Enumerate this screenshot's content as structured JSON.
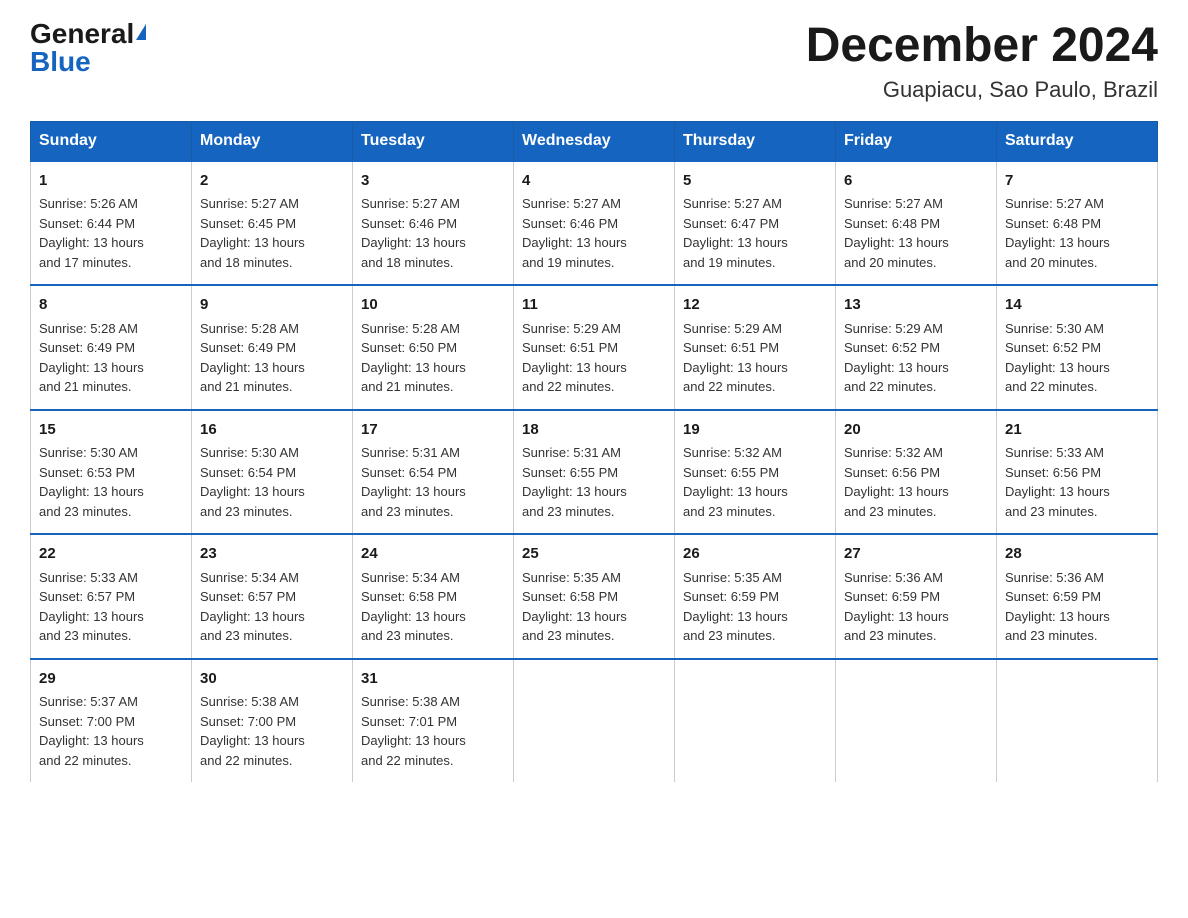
{
  "logo": {
    "general": "General",
    "blue": "Blue"
  },
  "title": "December 2024",
  "subtitle": "Guapiacu, Sao Paulo, Brazil",
  "days_of_week": [
    "Sunday",
    "Monday",
    "Tuesday",
    "Wednesday",
    "Thursday",
    "Friday",
    "Saturday"
  ],
  "weeks": [
    [
      {
        "day": "1",
        "sunrise": "5:26 AM",
        "sunset": "6:44 PM",
        "daylight": "13 hours and 17 minutes."
      },
      {
        "day": "2",
        "sunrise": "5:27 AM",
        "sunset": "6:45 PM",
        "daylight": "13 hours and 18 minutes."
      },
      {
        "day": "3",
        "sunrise": "5:27 AM",
        "sunset": "6:46 PM",
        "daylight": "13 hours and 18 minutes."
      },
      {
        "day": "4",
        "sunrise": "5:27 AM",
        "sunset": "6:46 PM",
        "daylight": "13 hours and 19 minutes."
      },
      {
        "day": "5",
        "sunrise": "5:27 AM",
        "sunset": "6:47 PM",
        "daylight": "13 hours and 19 minutes."
      },
      {
        "day": "6",
        "sunrise": "5:27 AM",
        "sunset": "6:48 PM",
        "daylight": "13 hours and 20 minutes."
      },
      {
        "day": "7",
        "sunrise": "5:27 AM",
        "sunset": "6:48 PM",
        "daylight": "13 hours and 20 minutes."
      }
    ],
    [
      {
        "day": "8",
        "sunrise": "5:28 AM",
        "sunset": "6:49 PM",
        "daylight": "13 hours and 21 minutes."
      },
      {
        "day": "9",
        "sunrise": "5:28 AM",
        "sunset": "6:49 PM",
        "daylight": "13 hours and 21 minutes."
      },
      {
        "day": "10",
        "sunrise": "5:28 AM",
        "sunset": "6:50 PM",
        "daylight": "13 hours and 21 minutes."
      },
      {
        "day": "11",
        "sunrise": "5:29 AM",
        "sunset": "6:51 PM",
        "daylight": "13 hours and 22 minutes."
      },
      {
        "day": "12",
        "sunrise": "5:29 AM",
        "sunset": "6:51 PM",
        "daylight": "13 hours and 22 minutes."
      },
      {
        "day": "13",
        "sunrise": "5:29 AM",
        "sunset": "6:52 PM",
        "daylight": "13 hours and 22 minutes."
      },
      {
        "day": "14",
        "sunrise": "5:30 AM",
        "sunset": "6:52 PM",
        "daylight": "13 hours and 22 minutes."
      }
    ],
    [
      {
        "day": "15",
        "sunrise": "5:30 AM",
        "sunset": "6:53 PM",
        "daylight": "13 hours and 23 minutes."
      },
      {
        "day": "16",
        "sunrise": "5:30 AM",
        "sunset": "6:54 PM",
        "daylight": "13 hours and 23 minutes."
      },
      {
        "day": "17",
        "sunrise": "5:31 AM",
        "sunset": "6:54 PM",
        "daylight": "13 hours and 23 minutes."
      },
      {
        "day": "18",
        "sunrise": "5:31 AM",
        "sunset": "6:55 PM",
        "daylight": "13 hours and 23 minutes."
      },
      {
        "day": "19",
        "sunrise": "5:32 AM",
        "sunset": "6:55 PM",
        "daylight": "13 hours and 23 minutes."
      },
      {
        "day": "20",
        "sunrise": "5:32 AM",
        "sunset": "6:56 PM",
        "daylight": "13 hours and 23 minutes."
      },
      {
        "day": "21",
        "sunrise": "5:33 AM",
        "sunset": "6:56 PM",
        "daylight": "13 hours and 23 minutes."
      }
    ],
    [
      {
        "day": "22",
        "sunrise": "5:33 AM",
        "sunset": "6:57 PM",
        "daylight": "13 hours and 23 minutes."
      },
      {
        "day": "23",
        "sunrise": "5:34 AM",
        "sunset": "6:57 PM",
        "daylight": "13 hours and 23 minutes."
      },
      {
        "day": "24",
        "sunrise": "5:34 AM",
        "sunset": "6:58 PM",
        "daylight": "13 hours and 23 minutes."
      },
      {
        "day": "25",
        "sunrise": "5:35 AM",
        "sunset": "6:58 PM",
        "daylight": "13 hours and 23 minutes."
      },
      {
        "day": "26",
        "sunrise": "5:35 AM",
        "sunset": "6:59 PM",
        "daylight": "13 hours and 23 minutes."
      },
      {
        "day": "27",
        "sunrise": "5:36 AM",
        "sunset": "6:59 PM",
        "daylight": "13 hours and 23 minutes."
      },
      {
        "day": "28",
        "sunrise": "5:36 AM",
        "sunset": "6:59 PM",
        "daylight": "13 hours and 23 minutes."
      }
    ],
    [
      {
        "day": "29",
        "sunrise": "5:37 AM",
        "sunset": "7:00 PM",
        "daylight": "13 hours and 22 minutes."
      },
      {
        "day": "30",
        "sunrise": "5:38 AM",
        "sunset": "7:00 PM",
        "daylight": "13 hours and 22 minutes."
      },
      {
        "day": "31",
        "sunrise": "5:38 AM",
        "sunset": "7:01 PM",
        "daylight": "13 hours and 22 minutes."
      },
      null,
      null,
      null,
      null
    ]
  ],
  "labels": {
    "sunrise": "Sunrise:",
    "sunset": "Sunset:",
    "daylight": "Daylight:"
  }
}
